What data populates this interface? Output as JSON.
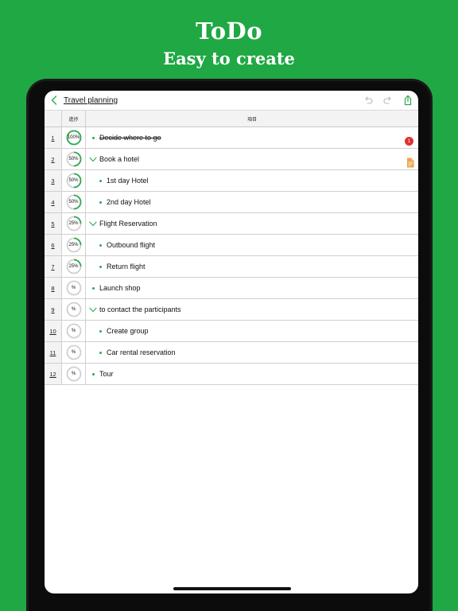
{
  "promo": {
    "title": "ToDo",
    "subtitle": "Easy to create"
  },
  "colors": {
    "background": "#1fa843",
    "accent": "#2fa84f",
    "ring_track": "#d0d0d0",
    "badge": "#e0312f",
    "note": "#e9a64a"
  },
  "navbar": {
    "back_icon": "chevron-left-icon",
    "title": "Travel planning",
    "undo_icon": "undo-icon",
    "redo_icon": "redo-icon",
    "share_icon": "share-icon"
  },
  "table": {
    "headers": {
      "progress": "進捗",
      "item": "項目"
    },
    "rows": [
      {
        "num": "1",
        "progress_label": "100%",
        "progress": 100,
        "text": "Decide where to go",
        "level": 0,
        "type": "bullet",
        "done": true,
        "badge": "1"
      },
      {
        "num": "2",
        "progress_label": "50%",
        "progress": 50,
        "text": "Book a hotel",
        "level": 0,
        "type": "chevron",
        "done": false,
        "note": true
      },
      {
        "num": "3",
        "progress_label": "50%",
        "progress": 50,
        "text": "1st day Hotel",
        "level": 1,
        "type": "bullet",
        "done": false
      },
      {
        "num": "4",
        "progress_label": "50%",
        "progress": 50,
        "text": "2nd day Hotel",
        "level": 1,
        "type": "bullet",
        "done": false
      },
      {
        "num": "5",
        "progress_label": "25%",
        "progress": 25,
        "text": "Flight Reservation",
        "level": 0,
        "type": "chevron",
        "done": false
      },
      {
        "num": "6",
        "progress_label": "25%",
        "progress": 25,
        "text": "Outbound flight",
        "level": 1,
        "type": "bullet",
        "done": false
      },
      {
        "num": "7",
        "progress_label": "25%",
        "progress": 25,
        "text": "Return flight",
        "level": 1,
        "type": "bullet",
        "done": false
      },
      {
        "num": "8",
        "progress_label": "%",
        "progress": 0,
        "text": "Launch shop",
        "level": 0,
        "type": "bullet",
        "done": false
      },
      {
        "num": "9",
        "progress_label": "%",
        "progress": 0,
        "text": "to contact the participants",
        "level": 0,
        "type": "chevron",
        "done": false
      },
      {
        "num": "10",
        "progress_label": "%",
        "progress": 0,
        "text": "Create group",
        "level": 1,
        "type": "bullet",
        "done": false
      },
      {
        "num": "11",
        "progress_label": "%",
        "progress": 0,
        "text": "Car rental reservation",
        "level": 1,
        "type": "bullet",
        "done": false
      },
      {
        "num": "12",
        "progress_label": "%",
        "progress": 0,
        "text": "Tour",
        "level": 0,
        "type": "bullet",
        "done": false
      }
    ]
  }
}
